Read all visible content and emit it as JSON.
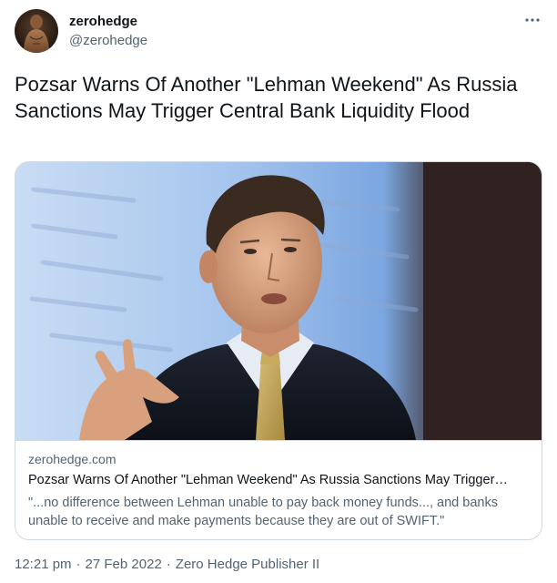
{
  "author": {
    "display_name": "zerohedge",
    "handle": "@zerohedge",
    "avatar_icon": "avatar-portrait-icon"
  },
  "more_icon": "ellipsis-icon",
  "tweet": {
    "text": "Pozsar Warns Of Another \"Lehman Weekend\" As Russia Sanctions May Trigger Central Bank Liquidity Flood"
  },
  "card": {
    "image_alt": "man-in-suit-speaking-photo",
    "domain": "zerohedge.com",
    "title": "Pozsar Warns Of Another \"Lehman Weekend\" As Russia Sanctions May Trigger…",
    "description": "\"...no difference between Lehman unable to pay back money funds..., and banks unable to receive and make payments because they are out of SWIFT.\""
  },
  "meta": {
    "time": "12:21 pm",
    "separator": "·",
    "date": "27 Feb 2022",
    "source": "Zero Hedge Publisher II"
  },
  "colors": {
    "text_primary": "#0f1419",
    "text_secondary": "#536471",
    "border": "#cfd9de"
  }
}
